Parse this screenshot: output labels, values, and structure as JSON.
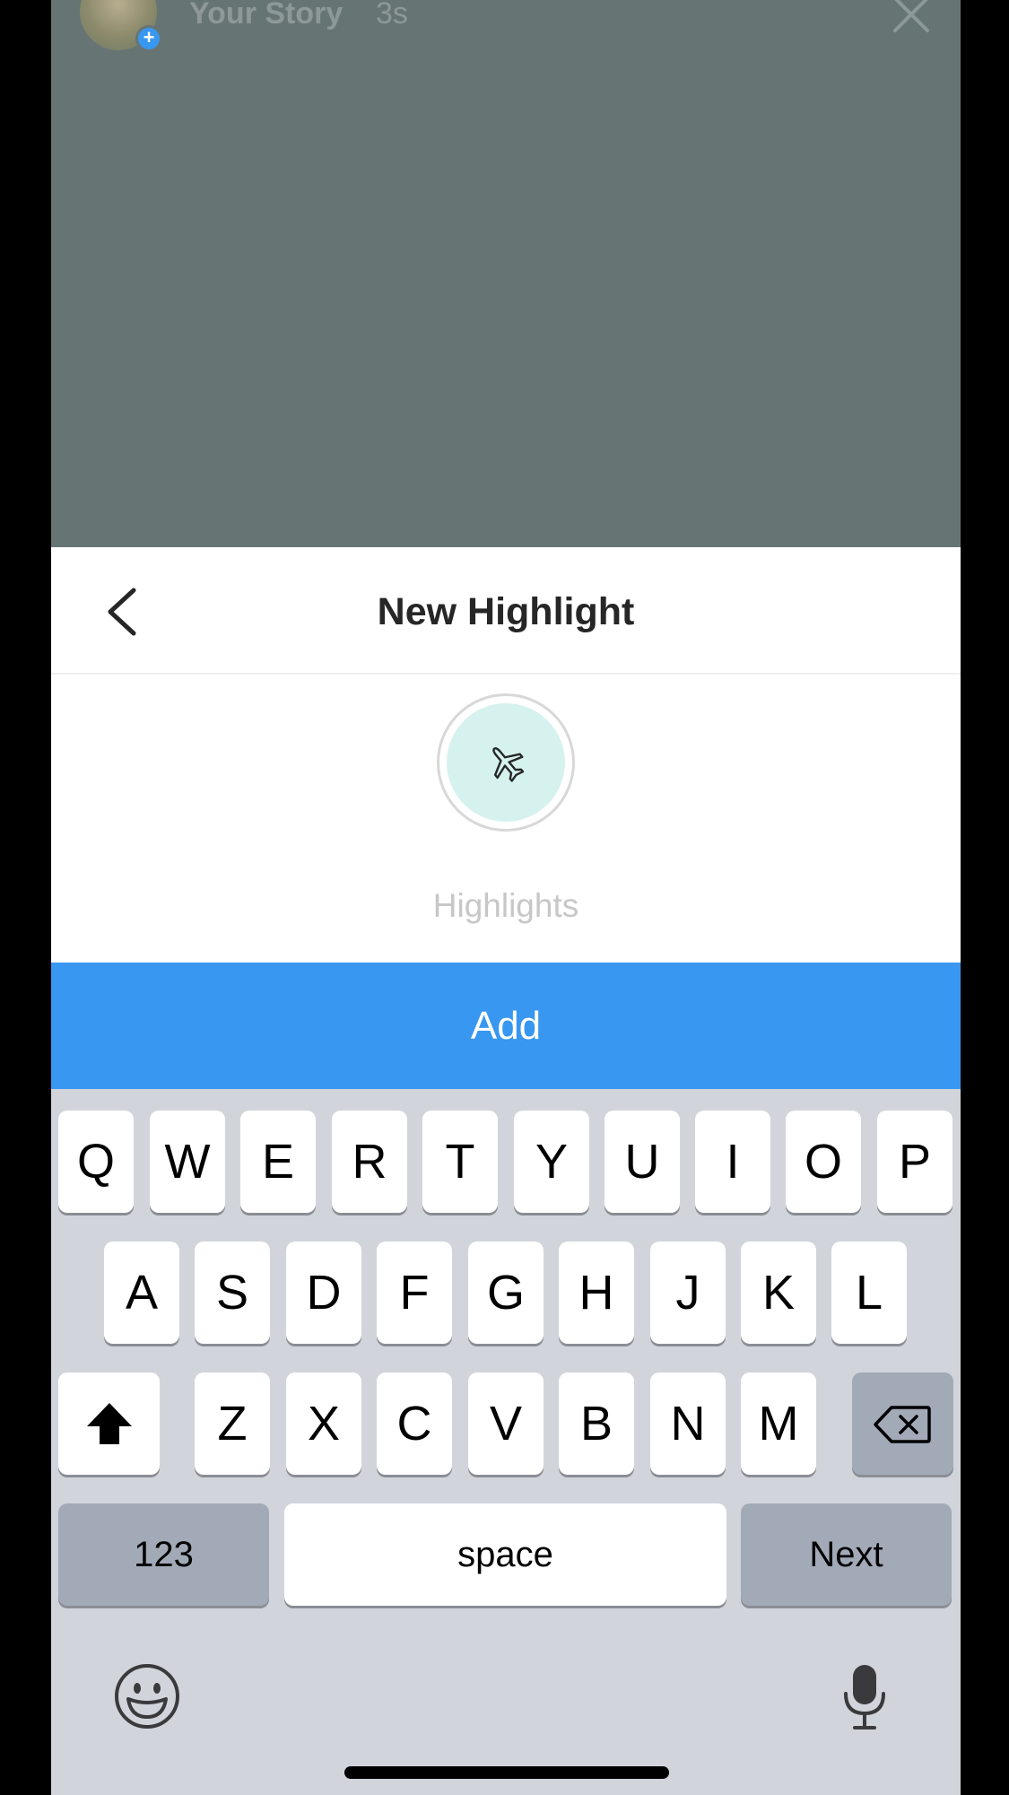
{
  "story": {
    "user_label": "Your Story",
    "time": "3s"
  },
  "sheet": {
    "title": "New Highlight",
    "cover_icon": "airplane-icon",
    "name_placeholder": "Highlights",
    "name_value": ""
  },
  "add_button": {
    "label": "Add"
  },
  "keyboard": {
    "row1": [
      "Q",
      "W",
      "E",
      "R",
      "T",
      "Y",
      "U",
      "I",
      "O",
      "P"
    ],
    "row2": [
      "A",
      "S",
      "D",
      "F",
      "G",
      "H",
      "J",
      "K",
      "L"
    ],
    "row3": [
      "Z",
      "X",
      "C",
      "V",
      "B",
      "N",
      "M"
    ],
    "numbers_label": "123",
    "space_label": "space",
    "return_label": "Next"
  },
  "colors": {
    "accent": "#3897f0",
    "story_bg": "#667574",
    "keyboard_bg": "#d1d5db"
  }
}
